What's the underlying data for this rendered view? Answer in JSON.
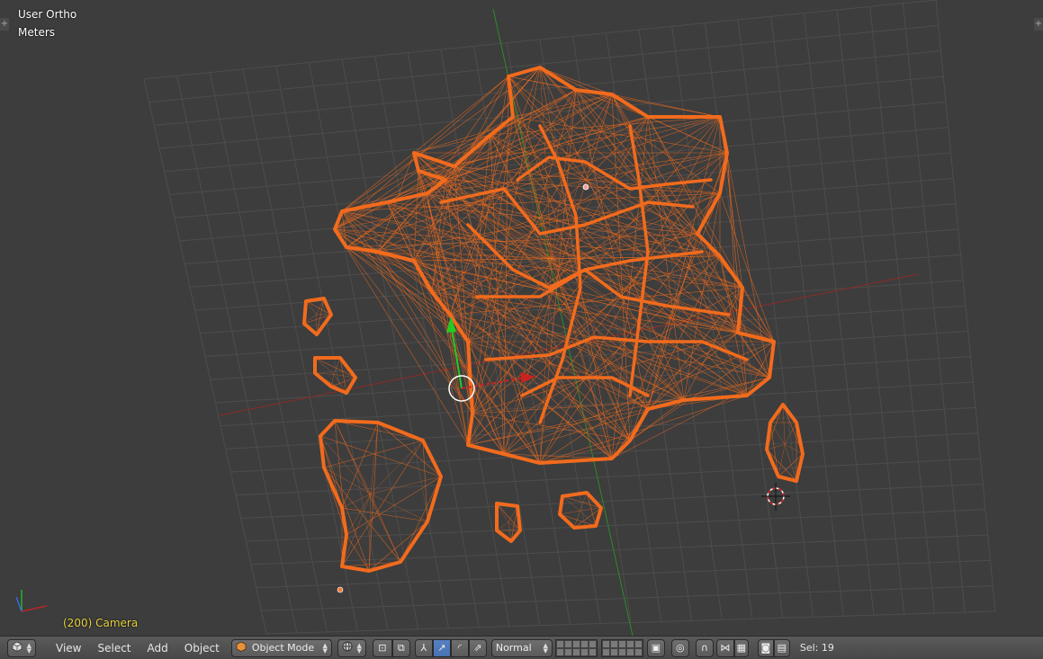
{
  "viewport": {
    "view_name": "User Ortho",
    "units": "Meters",
    "object_info": "(200) Camera",
    "colors": {
      "background": "#3d3d3d",
      "grid": "#4d4d4d",
      "x_axis": "#8c2a2a",
      "y_axis": "#2d8a2d",
      "mesh": "#f26b1d",
      "object_info_text": "#e6d23c"
    }
  },
  "header": {
    "editor_type_icon": "cube-icon",
    "menus": [
      "View",
      "Select",
      "Add",
      "Object"
    ],
    "mode": {
      "icon": "cube-orange-icon",
      "label": "Object Mode"
    },
    "pivot_icon": "pivot-sphere-icon",
    "orientation": {
      "label": "Normal"
    },
    "selection_count": "Sel: 19"
  }
}
